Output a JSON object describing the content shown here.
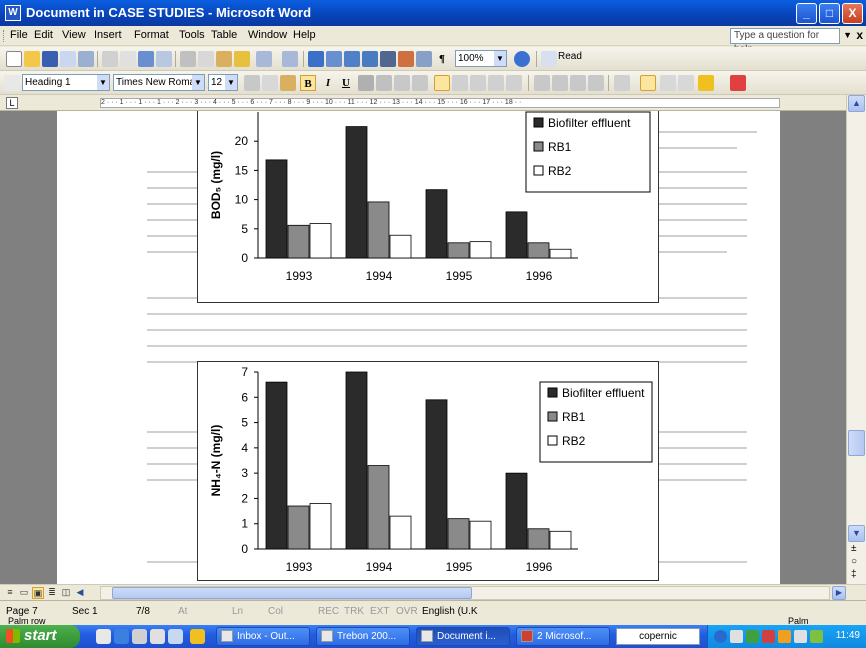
{
  "window": {
    "app_icon": "W",
    "title": "Document in CASE STUDIES - Microsoft Word",
    "controls": {
      "minimize": "_",
      "maximize": "□",
      "close": "X"
    }
  },
  "menu": {
    "items": [
      "File",
      "Edit",
      "View",
      "Insert",
      "Format",
      "Tools",
      "Table",
      "Window",
      "Help"
    ],
    "ask_placeholder": "Type a question for help",
    "close_glyph": "x"
  },
  "standard_toolbar": {
    "zoom": "100%",
    "pilcrow": "¶",
    "read_label": "Read"
  },
  "formatting_toolbar": {
    "style": "Heading 1",
    "font": "Times New Roman",
    "size": "12",
    "bold": "B",
    "italic": "I",
    "underline": "U"
  },
  "ruler": {
    "tab_selector": "L",
    "marks": "2 · · · 1 · · · 1 · · · 1 · · · 2 · · · 3 · · · 4 · · · 5 · · · 6 · · · 7 · · · 8 · · · 9 · · · 10 · · · 11 · · · 12 · · · 13 · · · 14 · · · 15 · · · 16 · · · 17 · · · 18 · ·"
  },
  "chart_data": [
    {
      "type": "bar",
      "categories": [
        "1993",
        "1994",
        "1995",
        "1996"
      ],
      "series": [
        {
          "name": "Biofilter effluent",
          "values": [
            16.8,
            22.5,
            11.7,
            7.9
          ]
        },
        {
          "name": "RB1",
          "values": [
            5.6,
            9.6,
            2.6,
            2.6
          ]
        },
        {
          "name": "RB2",
          "values": [
            5.9,
            3.9,
            2.8,
            1.5
          ]
        }
      ],
      "ylabel": "BOD₅ (mg/l)",
      "yticks": [
        "0",
        "5",
        "10",
        "15",
        "20"
      ],
      "ylim": [
        0,
        25
      ],
      "legend": "top-right",
      "grid": false
    },
    {
      "type": "bar",
      "categories": [
        "1993",
        "1994",
        "1995",
        "1996"
      ],
      "series": [
        {
          "name": "Biofilter effluent",
          "values": [
            6.6,
            7.0,
            5.9,
            3.0
          ]
        },
        {
          "name": "RB1",
          "values": [
            1.7,
            3.3,
            1.2,
            0.8
          ]
        },
        {
          "name": "RB2",
          "values": [
            1.8,
            1.3,
            1.1,
            0.7
          ]
        }
      ],
      "ylabel": "NH₄-N (mg/l)",
      "yticks": [
        "0",
        "1",
        "2",
        "3",
        "4",
        "5",
        "6",
        "7"
      ],
      "ylim": [
        0,
        7
      ],
      "legend": "top-right",
      "grid": false
    }
  ],
  "colors": {
    "biofilter": "#2b2b2b",
    "rb1": "#8a8a8a",
    "rb2": "#ffffff",
    "titlebar": "#0a5fe0",
    "taskbar": "#245ee0",
    "tray": "#0f8ae0",
    "start": "#2e8b2e"
  },
  "status": {
    "page": "Page 7",
    "section": "Sec 1",
    "pages": "7/8",
    "at": "At",
    "ln": "Ln",
    "col": "Col",
    "rec": "REC",
    "trk": "TRK",
    "ext": "EXT",
    "ovr": "OVR",
    "language": "English (U.K",
    "below_left": "Palm row",
    "below_right": "Palm"
  },
  "taskbar": {
    "start": "start",
    "tasks": [
      "Inbox - Out...",
      "Trebon 200...",
      "Document i...",
      "2 Microsof..."
    ],
    "search": "copernic",
    "clock": "11:49"
  }
}
